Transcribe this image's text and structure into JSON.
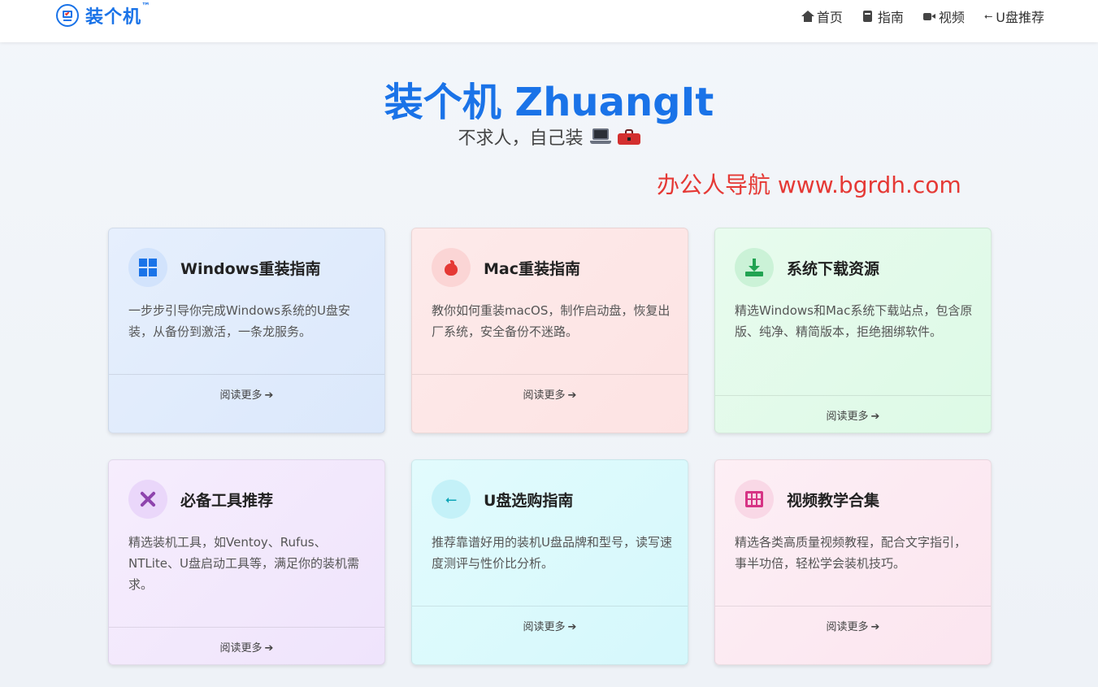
{
  "header": {
    "logo_text": "装个机",
    "logo_tm": "™",
    "nav": [
      {
        "label": "首页",
        "icon": "home-icon"
      },
      {
        "label": "指南",
        "icon": "book-icon"
      },
      {
        "label": "视频",
        "icon": "video-icon"
      },
      {
        "label": "U盘推荐",
        "icon": "usb-icon"
      }
    ]
  },
  "hero": {
    "title": "装个机 ZhuangIt",
    "subtitle": "不求人，自己装",
    "watermark": "办公人导航  www.bgrdh.com"
  },
  "cards": [
    {
      "title": "Windows重装指南",
      "desc": "一步步引导你完成Windows系统的U盘安装，从备份到激活，一条龙服务。",
      "link": "阅读更多",
      "icon": "windows-icon"
    },
    {
      "title": "Mac重装指南",
      "desc": "教你如何重装macOS，制作启动盘，恢复出厂系统，安全备份不迷路。",
      "link": "阅读更多",
      "icon": "apple-icon"
    },
    {
      "title": "系统下载资源",
      "desc": "精选Windows和Mac系统下载站点，包含原版、纯净、精简版本，拒绝捆绑软件。",
      "link": "阅读更多",
      "icon": "download-icon"
    },
    {
      "title": "必备工具推荐",
      "desc": "精选装机工具，如Ventoy、Rufus、NTLite、U盘启动工具等，满足你的装机需求。",
      "link": "阅读更多",
      "icon": "tools-icon"
    },
    {
      "title": "U盘选购指南",
      "desc": "推荐靠谱好用的装机U盘品牌和型号，读写速度测评与性价比分析。",
      "link": "阅读更多",
      "icon": "usb-icon"
    },
    {
      "title": "视频教学合集",
      "desc": "精选各类高质量视频教程，配合文字指引，事半功倍，轻松学会装机技巧。",
      "link": "阅读更多",
      "icon": "film-icon"
    }
  ],
  "colors": {
    "brand": "#1a73e8",
    "watermark": "#e53935"
  }
}
